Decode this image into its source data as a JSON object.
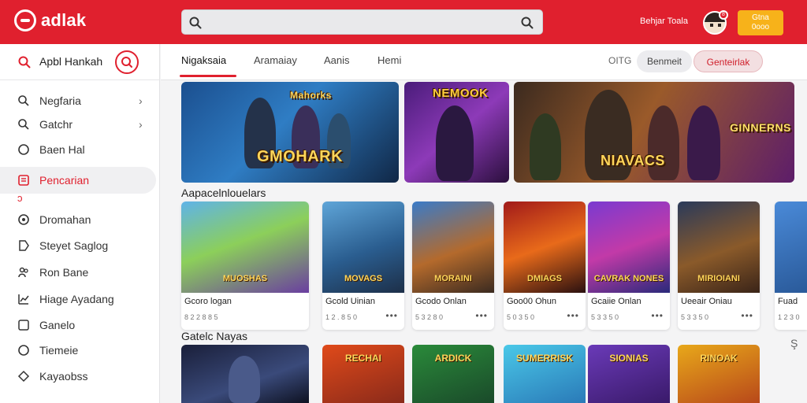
{
  "colors": {
    "accent": "#e0202e",
    "cta": "#f7b21a"
  },
  "header": {
    "logo_text": "adlak",
    "search_placeholder": "",
    "user_name": "Behjar Toala",
    "notif_count": "8",
    "cta_label_top": "Gtna",
    "cta_label_bottom": "0ooo"
  },
  "sidebar": {
    "heading": "Apbl Hankah",
    "items": [
      {
        "label": "Negfaria",
        "icon": "search-icon",
        "chevron": true
      },
      {
        "label": "Gatchr",
        "icon": "search-icon",
        "chevron": true
      },
      {
        "label": "Baen Hal",
        "icon": "circle-icon",
        "chevron": false
      },
      {
        "label": "Pencarian",
        "icon": "list-icon",
        "chevron": false,
        "active": true
      },
      {
        "label": "Dromahan",
        "icon": "circle-icon",
        "chevron": false
      },
      {
        "label": "Steyet Saglog",
        "icon": "tag-icon",
        "chevron": false
      },
      {
        "label": "Ron Bane",
        "icon": "people-icon",
        "chevron": false
      },
      {
        "label": "Hiage Ayadang",
        "icon": "chart-icon",
        "chevron": false
      },
      {
        "label": "Ganelo",
        "icon": "square-icon",
        "chevron": false
      },
      {
        "label": "Tiemeie",
        "icon": "circle-icon",
        "chevron": false
      },
      {
        "label": "Kayaobss",
        "icon": "tag-icon",
        "chevron": false
      }
    ]
  },
  "tabs": {
    "items": [
      "Nigaksaia",
      "Aramaiay",
      "Aanis",
      "Hemi"
    ],
    "meta": "OITG",
    "pill_grey": "Benmeit",
    "pill_red": "Genteirlak"
  },
  "banners": [
    {
      "title_top": "Mahorks",
      "title_main": "GMOHARK"
    },
    {
      "title_main": "NEMOOK"
    },
    {
      "title_main": "NIAVACS",
      "title_side": "GINNERNS"
    }
  ],
  "sections": {
    "section1": "Aapacelnlouelars",
    "section2": "Gatelc Nayas"
  },
  "cards": [
    {
      "thumb_label": "MUOSHAS",
      "title": "Gcoro logan",
      "meta": "8 2 2 8 8 5"
    },
    {
      "thumb_label": "MOVAGS",
      "title": "Gcold Uinian",
      "meta": "1 2 . 8 5 0"
    },
    {
      "thumb_label": "MORAINI",
      "title": "Gcodo Onlan",
      "meta": "5 3 2 8 0"
    },
    {
      "thumb_label": "DMIAGS",
      "title": "Goo00 Ohun",
      "meta": "5 0 3 5 0"
    },
    {
      "thumb_label": "CAVRAK NONES",
      "title": "Gcaiie Onlan",
      "meta": "5 3 3 5 0"
    },
    {
      "thumb_label": "MIRIOIANI",
      "title": "Ueeair Oniau",
      "meta": "5 3 3 5 0"
    },
    {
      "thumb_label": "",
      "title": "Fuad",
      "meta": "1 2 3 0"
    }
  ],
  "cards_row2": [
    {
      "thumb_label": ""
    },
    {
      "thumb_label": "RECHAI"
    },
    {
      "thumb_label": "ARDICK"
    },
    {
      "thumb_label": "SUMERRISK"
    },
    {
      "thumb_label": "SIONIAS"
    },
    {
      "thumb_label": "RINOAK"
    }
  ],
  "more_label": "•••",
  "scroll_hint": "Ş"
}
